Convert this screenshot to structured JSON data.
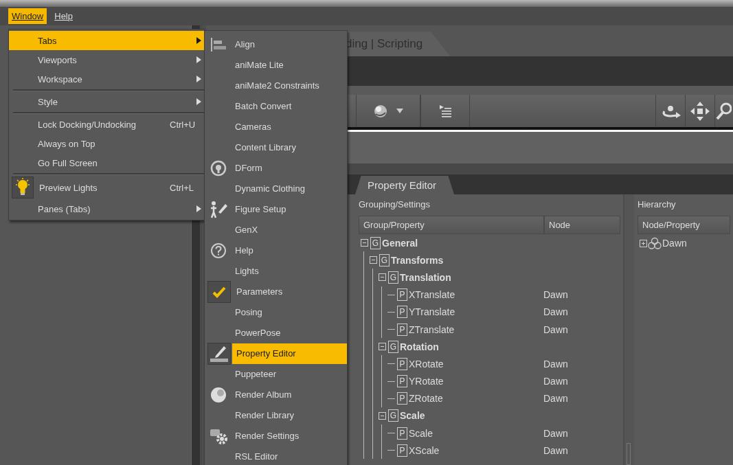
{
  "menubar": [
    {
      "label": "Window",
      "selected": true
    },
    {
      "label": "Help",
      "selected": false
    }
  ],
  "document_tab": {
    "label": "ding | Scripting"
  },
  "window_menu": [
    {
      "kind": "item",
      "label": "Tabs",
      "submenu": true,
      "selected": true,
      "checked": false
    },
    {
      "kind": "item",
      "label": "Viewports",
      "submenu": true,
      "selected": false,
      "checked": false
    },
    {
      "kind": "item",
      "label": "Workspace",
      "submenu": true,
      "selected": false,
      "checked": false
    },
    {
      "kind": "separator"
    },
    {
      "kind": "item",
      "label": "Style",
      "submenu": true,
      "selected": false,
      "checked": false
    },
    {
      "kind": "separator"
    },
    {
      "kind": "item",
      "label": "Lock Docking/Undocking",
      "shortcut": "Ctrl+U",
      "submenu": false,
      "selected": false,
      "checked": false
    },
    {
      "kind": "item",
      "label": "Always on Top",
      "submenu": false,
      "selected": false,
      "checked": false
    },
    {
      "kind": "item",
      "label": "Go Full Screen",
      "submenu": false,
      "selected": false,
      "checked": false
    },
    {
      "kind": "separator"
    },
    {
      "kind": "item",
      "label": "Preview Lights",
      "shortcut": "Ctrl+L",
      "submenu": false,
      "selected": false,
      "checked": true
    },
    {
      "kind": "item",
      "label": "Panes (Tabs)",
      "submenu": true,
      "selected": false,
      "checked": false
    }
  ],
  "tabs_submenu": [
    {
      "label": "Align",
      "selected": false,
      "checked": false
    },
    {
      "label": "aniMate Lite",
      "selected": false,
      "checked": false
    },
    {
      "label": "aniMate2 Constraints",
      "selected": false,
      "checked": false
    },
    {
      "label": "Batch Convert",
      "selected": false,
      "checked": false
    },
    {
      "label": "Cameras",
      "selected": false,
      "checked": false
    },
    {
      "label": "Content Library",
      "selected": false,
      "checked": false
    },
    {
      "label": "DForm",
      "selected": false,
      "checked": false
    },
    {
      "label": "Dynamic Clothing",
      "selected": false,
      "checked": false
    },
    {
      "label": "Figure Setup",
      "selected": false,
      "checked": false
    },
    {
      "label": "GenX",
      "selected": false,
      "checked": false
    },
    {
      "label": "Help",
      "selected": false,
      "checked": false
    },
    {
      "label": "Lights",
      "selected": false,
      "checked": false
    },
    {
      "label": "Parameters",
      "selected": false,
      "checked": true
    },
    {
      "label": "Posing",
      "selected": false,
      "checked": false
    },
    {
      "label": "PowerPose",
      "selected": false,
      "checked": false
    },
    {
      "label": "Property Editor",
      "selected": true,
      "checked": true
    },
    {
      "label": "Puppeteer",
      "selected": false,
      "checked": false
    },
    {
      "label": "Render Album",
      "selected": false,
      "checked": false
    },
    {
      "label": "Render Library",
      "selected": false,
      "checked": false
    },
    {
      "label": "Render Settings",
      "selected": false,
      "checked": false
    },
    {
      "label": "RSL Editor",
      "selected": false,
      "checked": false
    }
  ],
  "property_editor": {
    "tab": "Property Editor",
    "grouping": {
      "title": "Grouping/Settings",
      "columns": [
        "Group/Property",
        "Node"
      ],
      "tree": [
        {
          "kind": "group",
          "badge": "G",
          "label": "General",
          "expanded": true,
          "children": [
            {
              "kind": "group",
              "badge": "G",
              "label": "Transforms",
              "expanded": true,
              "children": [
                {
                  "kind": "group",
                  "badge": "G",
                  "label": "Translation",
                  "expanded": true,
                  "children": [
                    {
                      "kind": "property",
                      "badge": "P",
                      "label": "XTranslate",
                      "node": "Dawn"
                    },
                    {
                      "kind": "property",
                      "badge": "P",
                      "label": "YTranslate",
                      "node": "Dawn"
                    },
                    {
                      "kind": "property",
                      "badge": "P",
                      "label": "ZTranslate",
                      "node": "Dawn"
                    }
                  ]
                },
                {
                  "kind": "group",
                  "badge": "G",
                  "label": "Rotation",
                  "expanded": true,
                  "children": [
                    {
                      "kind": "property",
                      "badge": "P",
                      "label": "XRotate",
                      "node": "Dawn"
                    },
                    {
                      "kind": "property",
                      "badge": "P",
                      "label": "YRotate",
                      "node": "Dawn"
                    },
                    {
                      "kind": "property",
                      "badge": "P",
                      "label": "ZRotate",
                      "node": "Dawn"
                    }
                  ]
                },
                {
                  "kind": "group",
                  "badge": "G",
                  "label": "Scale",
                  "expanded": true,
                  "children": [
                    {
                      "kind": "property",
                      "badge": "P",
                      "label": "Scale",
                      "node": "Dawn"
                    },
                    {
                      "kind": "property",
                      "badge": "P",
                      "label": "XScale",
                      "node": "Dawn"
                    }
                  ]
                }
              ]
            }
          ]
        }
      ]
    },
    "hierarchy": {
      "title": "Hierarchy",
      "columns": [
        "Node/Property"
      ],
      "tree": [
        {
          "label": "Dawn",
          "expanded": false
        }
      ]
    }
  }
}
